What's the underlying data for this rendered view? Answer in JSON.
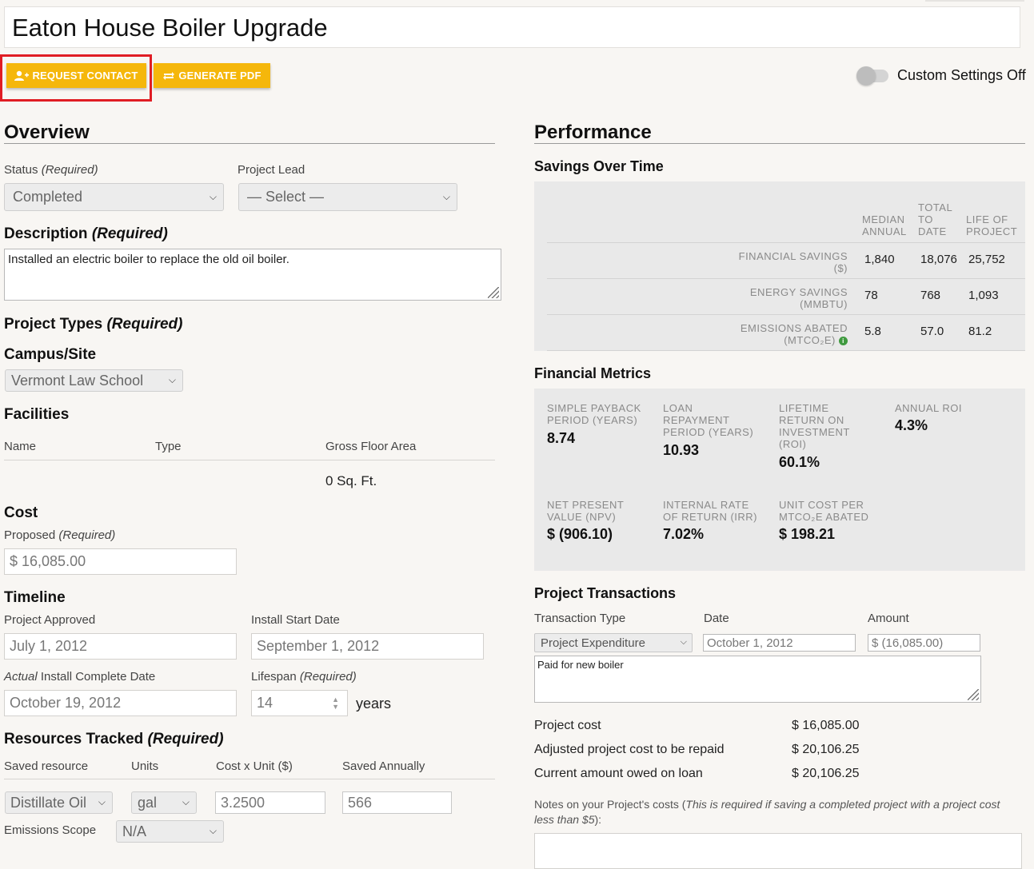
{
  "page": {
    "title": "Eaton House Boiler Upgrade"
  },
  "actions": {
    "request_contact": "REQUEST CONTACT",
    "generate_pdf": "GENERATE PDF",
    "custom_settings": "Custom Settings Off"
  },
  "overview": {
    "heading": "Overview",
    "status_label": "Status",
    "status_required": "(Required)",
    "status_value": "Completed",
    "lead_label": "Project Lead",
    "lead_value": "— Select —",
    "description_label": "Description",
    "description_required": "(Required)",
    "description_value": "Installed an electric boiler to replace the old oil boiler.",
    "project_types_label": "Project Types",
    "project_types_required": "(Required)",
    "campus_label": "Campus/Site",
    "campus_value": "Vermont Law School",
    "facilities_label": "Facilities",
    "facilities_columns": [
      "Name",
      "Type",
      "Gross Floor Area"
    ],
    "facilities_total": "0 Sq. Ft.",
    "cost_label": "Cost",
    "proposed_label": "Proposed",
    "proposed_required": "(Required)",
    "proposed_value": "$ 16,085.00",
    "timeline_label": "Timeline",
    "approved_label": "Project Approved",
    "approved_value": "July 1, 2012",
    "install_start_label": "Install Start Date",
    "install_start_value": "September 1, 2012",
    "actual_label_italic": "Actual",
    "actual_label_rest": " Install Complete Date",
    "actual_value": "October 19, 2012",
    "lifespan_label": "Lifespan",
    "lifespan_required": "(Required)",
    "lifespan_value": "14",
    "lifespan_unit": "years",
    "resources_label": "Resources Tracked",
    "resources_required": "(Required)",
    "resources_columns": [
      "Saved resource",
      "Units",
      "Cost x Unit ($)",
      "Saved Annually"
    ],
    "resource_value": "Distillate Oil",
    "units_value": "gal",
    "cost_unit_value": "3.2500",
    "saved_annually_value": "566",
    "emissions_scope_label": "Emissions Scope",
    "emissions_scope_value": "N/A"
  },
  "performance": {
    "heading": "Performance",
    "savings_heading": "Savings Over Time",
    "savings_columns": [
      "MEDIAN ANNUAL",
      "TOTAL TO DATE",
      "LIFE OF PROJECT"
    ],
    "savings_rows": [
      {
        "label": "FINANCIAL SAVINGS",
        "unit": "($)",
        "median": "1,840",
        "total": "18,076",
        "life": "25,752"
      },
      {
        "label": "ENERGY SAVINGS",
        "unit": "(MMBTU)",
        "median": "78",
        "total": "768",
        "life": "1,093"
      },
      {
        "label": "EMISSIONS ABATED",
        "unit": "(MTCO₂E)",
        "median": "5.8",
        "total": "57.0",
        "life": "81.2"
      }
    ],
    "financial_heading": "Financial Metrics",
    "metrics": [
      {
        "label": "SIMPLE PAYBACK PERIOD (YEARS)",
        "value": "8.74"
      },
      {
        "label": "LOAN REPAYMENT PERIOD (YEARS)",
        "value": "10.93"
      },
      {
        "label": "LIFETIME RETURN ON INVESTMENT (ROI)",
        "value": "60.1%"
      },
      {
        "label": "ANNUAL ROI",
        "value": "4.3%"
      },
      {
        "label": "NET PRESENT VALUE (NPV)",
        "value": "$ (906.10)"
      },
      {
        "label": "INTERNAL RATE OF RETURN (IRR)",
        "value": "7.02%"
      },
      {
        "label": "UNIT COST PER MTCO₂E ABATED",
        "value": "$ 198.21"
      }
    ],
    "transactions_heading": "Project Transactions",
    "transaction_columns": [
      "Transaction Type",
      "Date",
      "Amount"
    ],
    "transaction_type": "Project Expenditure",
    "transaction_date": "October 1, 2012",
    "transaction_amount": "$ (16,085.00)",
    "transaction_note": "Paid for new boiler",
    "summary": [
      {
        "label": "Project cost",
        "value": "$ 16,085.00"
      },
      {
        "label": "Adjusted project cost to be repaid",
        "value": "$ 20,106.25"
      },
      {
        "label": "Current amount owed on loan",
        "value": "$ 20,106.25"
      }
    ],
    "notes_label_start": "Notes on your Project's costs (",
    "notes_label_italic": "This is required if saving a completed project with a project cost less than $5",
    "notes_label_end": "):"
  }
}
